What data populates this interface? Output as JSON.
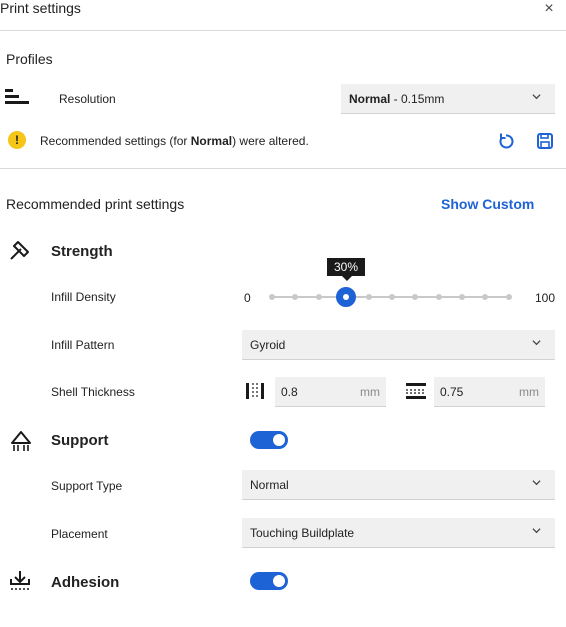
{
  "window": {
    "title": "Print settings",
    "close_glyph": "×"
  },
  "profiles": {
    "heading": "Profiles",
    "resolution_label": "Resolution",
    "resolution_value_bold": "Normal",
    "resolution_value_rest": " - 0.15mm",
    "warning_prefix": "Recommended settings (for ",
    "warning_bold": "Normal",
    "warning_suffix": ") were altered."
  },
  "recommended": {
    "heading": "Recommended print settings",
    "show_custom": "Show Custom"
  },
  "strength": {
    "title": "Strength",
    "infill_density_label": "Infill Density",
    "slider_min": "0",
    "slider_max": "100",
    "slider_value": 30,
    "slider_tooltip": "30%",
    "infill_pattern_label": "Infill Pattern",
    "infill_pattern_value": "Gyroid",
    "shell_thickness_label": "Shell Thickness",
    "wall_value": "0.8",
    "wall_unit": "mm",
    "topbottom_value": "0.75",
    "topbottom_unit": "mm"
  },
  "support": {
    "title": "Support",
    "enabled": true,
    "support_type_label": "Support Type",
    "support_type_value": "Normal",
    "placement_label": "Placement",
    "placement_value": "Touching Buildplate"
  },
  "adhesion": {
    "title": "Adhesion",
    "enabled": true
  },
  "colors": {
    "accent": "#1e63d6",
    "warning": "#f5c518"
  }
}
